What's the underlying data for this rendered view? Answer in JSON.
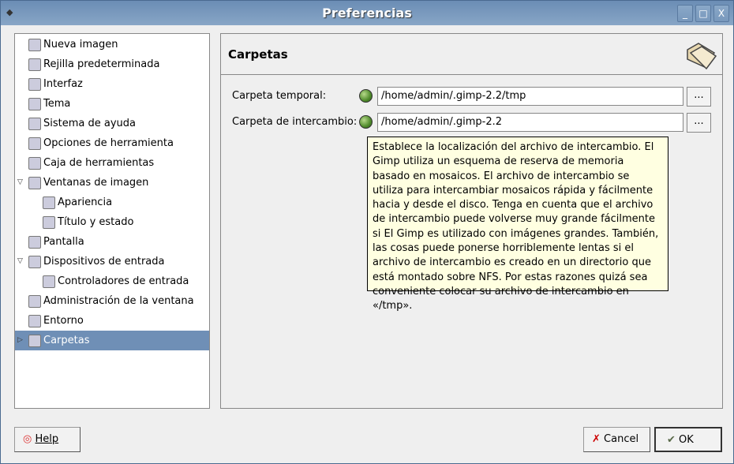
{
  "window": {
    "title": "Preferencias",
    "controls": [
      "_",
      "□",
      "X"
    ]
  },
  "sidebar": {
    "items": [
      {
        "label": "Nueva imagen",
        "icon": "new-image-icon",
        "level": 0
      },
      {
        "label": "Rejilla predeterminada",
        "icon": "grid-icon",
        "level": 0
      },
      {
        "label": "Interfaz",
        "icon": "interface-icon",
        "level": 0
      },
      {
        "label": "Tema",
        "icon": "theme-icon",
        "level": 0
      },
      {
        "label": "Sistema de ayuda",
        "icon": "help-system-icon",
        "level": 0
      },
      {
        "label": "Opciones de herramienta",
        "icon": "tool-options-icon",
        "level": 0
      },
      {
        "label": "Caja de herramientas",
        "icon": "toolbox-icon",
        "level": 0
      },
      {
        "label": "Ventanas de imagen",
        "icon": "image-windows-icon",
        "level": 0,
        "expanded": true
      },
      {
        "label": "Apariencia",
        "icon": "appearance-icon",
        "level": 1
      },
      {
        "label": "Título y estado",
        "icon": "title-status-icon",
        "level": 1
      },
      {
        "label": "Pantalla",
        "icon": "display-icon",
        "level": 0
      },
      {
        "label": "Dispositivos de entrada",
        "icon": "input-devices-icon",
        "level": 0,
        "expanded": true
      },
      {
        "label": "Controladores de entrada",
        "icon": "input-controllers-icon",
        "level": 1
      },
      {
        "label": "Administración de la ventana",
        "icon": "window-management-icon",
        "level": 0
      },
      {
        "label": "Entorno",
        "icon": "environment-icon",
        "level": 0
      },
      {
        "label": "Carpetas",
        "icon": "folders-icon",
        "level": 0,
        "selected": true,
        "collapsed": true
      }
    ]
  },
  "main": {
    "header": "Carpetas",
    "fields": [
      {
        "label": "Carpeta temporal:",
        "value": "/home/admin/.gimp-2.2/tmp",
        "browse": "..."
      },
      {
        "label": "Carpeta de intercambio:",
        "value": "/home/admin/.gimp-2.2",
        "browse": "..."
      }
    ],
    "tooltip": "Establece la localización del archivo de intercambio. El Gimp utiliza un esquema de reserva de memoria basado en mosaicos. El archivo de intercambio se utiliza para intercambiar mosaicos rápida y fácilmente hacia y desde el disco. Tenga en cuenta que el archivo de intercambio puede volverse muy grande fácilmente si El Gimp es utilizado con imágenes grandes. También, las cosas puede ponerse horriblemente lentas si el archivo de intercambio es creado en un directorio que está montado sobre NFS. Por estas razones quizá sea conveniente colocar su archivo de intercambio en «/tmp»."
  },
  "buttons": {
    "help": "Help",
    "cancel": "Cancel",
    "ok": "OK"
  },
  "colors": {
    "selection": "#6f8fb6",
    "tooltip_bg": "#ffffe1",
    "titlebar": "#7898bc"
  }
}
